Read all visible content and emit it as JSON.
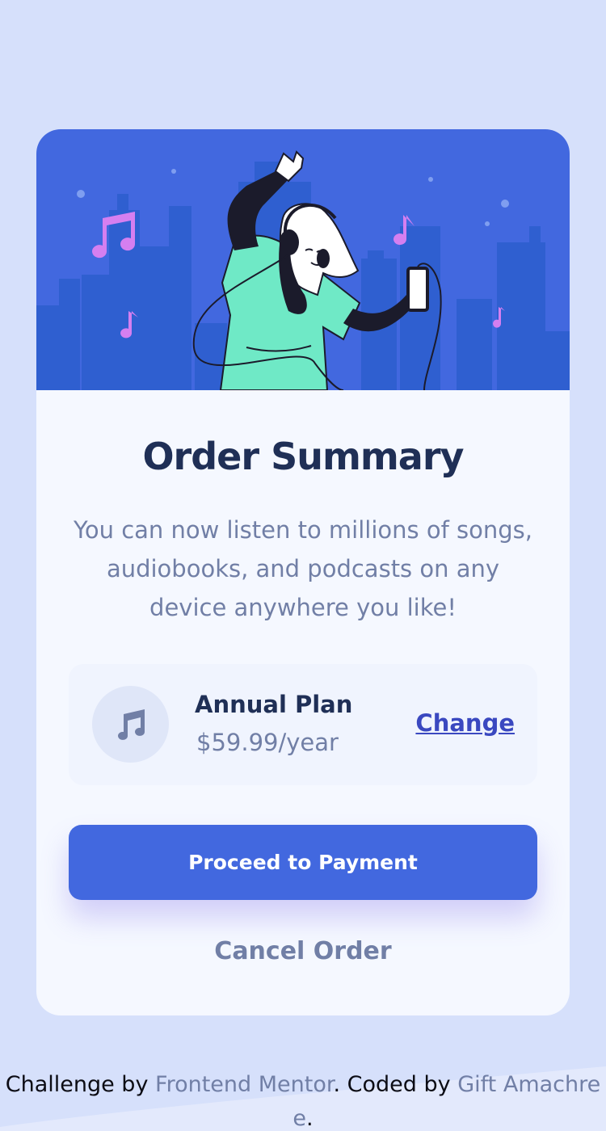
{
  "card": {
    "title": "Order Summary",
    "description": "You can now listen to millions of songs, audiobooks, and podcasts on any device anywhere you like!",
    "plan": {
      "name": "Annual Plan",
      "price": "$59.99/year",
      "change_label": "Change"
    },
    "primary_button_label": "Proceed to Payment",
    "secondary_button_label": "Cancel Order"
  },
  "footer": {
    "prefix": "Challenge by ",
    "challenge_link": "Frontend Mentor",
    "middle": ". Coded by ",
    "author_link": "Gift Amachree",
    "suffix": "."
  },
  "colors": {
    "page_background": "#d6e0fb",
    "card_background": "#f5f8ff",
    "hero_background": "#4268df",
    "primary": "#4268df",
    "title": "#1f2f56",
    "muted": "#717fa6",
    "link": "#3a48c0",
    "accent_notes": "#d57ff0"
  }
}
